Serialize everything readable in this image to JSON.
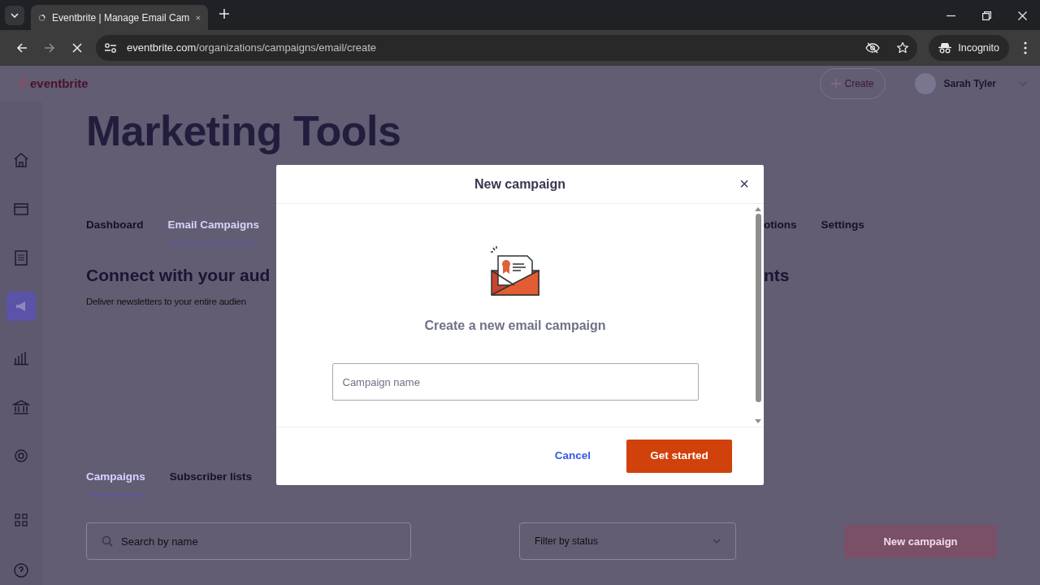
{
  "browser": {
    "tab_title": "Eventbrite | Manage Email Cam",
    "tab_selected": true,
    "url_domain": "eventbrite.com",
    "url_path": "/organizations/campaigns/email/create",
    "profile": "Incognito"
  },
  "header": {
    "logo": "eventbrite",
    "create_button": "Create",
    "user_name": "Sarah Tyler"
  },
  "sidebar": {
    "items": [
      {
        "selected": false
      },
      {
        "selected": false
      },
      {
        "selected": false
      },
      {
        "selected": true
      },
      {
        "selected": false
      },
      {
        "selected": false
      },
      {
        "selected": false
      },
      {
        "selected": false
      },
      {
        "selected": false
      }
    ]
  },
  "page": {
    "title": "Marketing Tools",
    "tabs_left": [
      {
        "label": "Dashboard",
        "selected": false
      },
      {
        "label": "Email Campaigns",
        "selected": true
      }
    ],
    "tabs_right": [
      {
        "label": "otions",
        "selected": false
      },
      {
        "label": "Settings",
        "selected": false
      }
    ],
    "heading_left": "Connect with your aud",
    "heading_right": "nts",
    "subtitle": "Deliver newsletters to your entire audien",
    "subtabs": [
      {
        "label": "Campaigns",
        "selected": true
      },
      {
        "label": "Subscriber lists",
        "selected": false
      }
    ],
    "search": {
      "placeholder": "Search by name"
    },
    "filter": {
      "placeholder": "Filter by status"
    },
    "new_campaign_button": "New campaign"
  },
  "modal": {
    "title": "New campaign",
    "close": "×",
    "prompt": "Create a new email campaign",
    "name_field": {
      "placeholder": "Campaign name"
    },
    "cancel_button": "Cancel",
    "submit_button": "Get started"
  }
}
